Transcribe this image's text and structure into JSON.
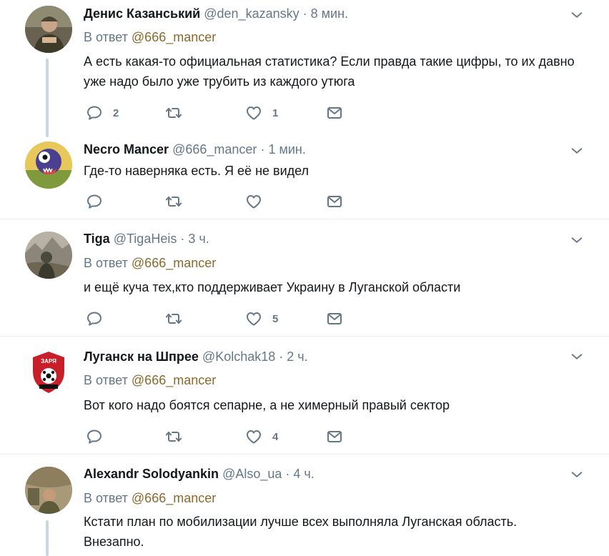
{
  "tweets": [
    {
      "name": "Денис Казанський",
      "handle": "@den_kazansky",
      "time": "8 мин.",
      "reply_prefix": "В ответ",
      "reply_to": "@666_mancer",
      "text": "А есть какая-то официальная статистика? Если правда такие цифры, то их давно уже надо было уже трубить из каждого утюга",
      "replies": "2",
      "retweets": "",
      "likes": "1"
    },
    {
      "name": "Necro Mancer",
      "handle": "@666_mancer",
      "time": "1 мин.",
      "text": "Где-то наверняка есть. Я её не видел",
      "replies": "",
      "retweets": "",
      "likes": ""
    },
    {
      "name": "Tiga",
      "handle": "@TigaHeis",
      "time": "3 ч.",
      "reply_prefix": "В ответ",
      "reply_to": "@666_mancer",
      "text": "и ещё куча тех,кто поддерживает Украину в Луганской области",
      "replies": "",
      "retweets": "",
      "likes": "5"
    },
    {
      "name": "Луганск на Шпрее",
      "handle": "@Kolchak18",
      "time": "2 ч.",
      "reply_prefix": "В ответ",
      "reply_to": "@666_mancer",
      "text": "Вот кого надо боятся сепарне, а не химерный правый сектор",
      "replies": "",
      "retweets": "",
      "likes": "4"
    },
    {
      "name": "Alexandr Solodyankin",
      "handle": "@Also_ua",
      "time": "4 ч.",
      "reply_prefix": "В ответ",
      "reply_to": "@666_mancer",
      "text_line1": "Кстати план по мобилизации лучше всех выполняла Луганская область.",
      "text_line2": "Внезапно."
    }
  ],
  "separator": "·",
  "logo_text": "ЗАРЯ",
  "icons": [
    "reply-icon",
    "retweet-icon",
    "like-icon",
    "direct-message-icon",
    "chevron-down-icon"
  ],
  "colors": {
    "text": "#14171a",
    "secondary": "#657786",
    "link": "#1da1f2",
    "divider": "#e6ecf0",
    "thread": "#ccd6dd"
  }
}
